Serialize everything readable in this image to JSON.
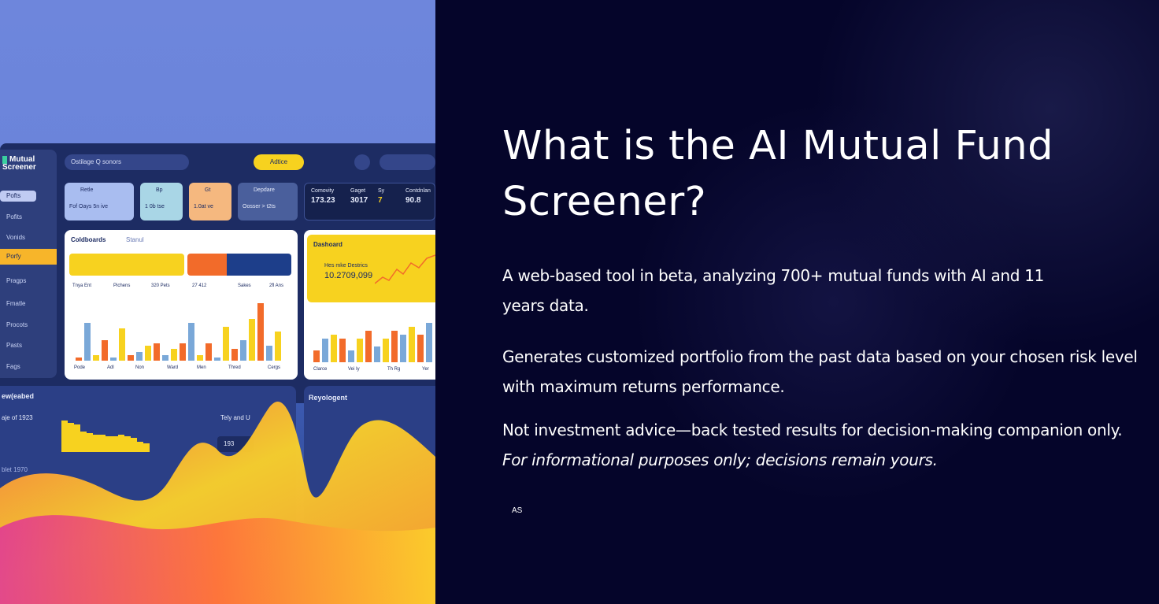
{
  "slide": {
    "title": "What is the AI Mutual Fund Screener?",
    "paragraph_1": "A web-based tool in beta, analyzing 700+ mutual funds with AI and 11 years data.",
    "paragraph_2": "Generates customized portfolio from the past data based on your chosen risk level with maximum returns  performance.",
    "paragraph_3_text": "Not investment advice—back tested results for decision-making companion only.",
    "paragraph_3_italic": "For informational purposes only; decisions remain yours.",
    "initials": "AS"
  },
  "illustration": {
    "logo": "Mutual Screener",
    "search_text": "Ostilage  Q sonors",
    "pill_label": "Adtice",
    "side_items": [
      "Pofts",
      "Pofits",
      "Vonids",
      "Porfy",
      "Pragps",
      "Fmatle",
      "Procots",
      "Pasts",
      "Fags"
    ],
    "cards": [
      {
        "line1": "Retle",
        "line2": "Fof Oays  5n ive"
      },
      {
        "line1": "Bp",
        "line2": "1 0b tse"
      },
      {
        "line1": "Gt",
        "line2": "1.0at ve"
      },
      {
        "line1": "Depdare",
        "line2": "Oosser > t2ts"
      }
    ],
    "stats": [
      {
        "label": "Comovity",
        "value": "173.23"
      },
      {
        "label": "Gaget",
        "value": "3017"
      },
      {
        "label": "Sy",
        "value": "7"
      },
      {
        "label": "Contdnlan",
        "value": "90.8"
      }
    ],
    "panel_1_tabs": [
      "Coldboards",
      "Stanul"
    ],
    "panel_1_row": [
      "Tnya Ent",
      "Pichens",
      "320 Pets",
      "27 412",
      "Sakes",
      "2fl Ans"
    ],
    "panel_1_xlabels": [
      "Pode",
      "Adl",
      "Non",
      "Ward",
      "Men",
      "Thred",
      "Cergs"
    ],
    "panel_2_title": "Dashoard",
    "panel_2_subtitle": "Hes mke Destrics",
    "panel_2_value": "10.2709,099",
    "panel_2_xlabels": [
      "Clarce",
      "Vei Iy",
      "Th Rg",
      "Yer"
    ],
    "bottom_left_title": "ew(eabed",
    "bottom_left_sub": "aje of 1923",
    "bottom_left_sub2": "Tely and U",
    "bottom_left_val": "193",
    "bottom_left_low": "blet 1970",
    "bottom_right_title": "Reyologent"
  },
  "colors": {
    "background": "#05052a",
    "accent_yellow": "#f7d21f",
    "accent_orange": "#f26b2a",
    "accent_blue": "#7aa8d8"
  }
}
